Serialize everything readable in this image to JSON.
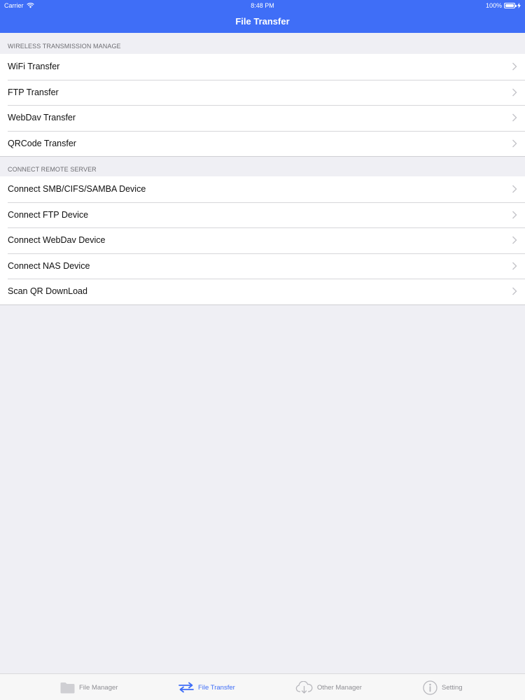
{
  "status_bar": {
    "carrier": "Carrier",
    "time": "8:48 PM",
    "battery_text": "100%",
    "battery_level": 1.0
  },
  "nav": {
    "title": "File Transfer"
  },
  "sections": [
    {
      "header": "WIRELESS TRANSMISSION MANAGE",
      "items": [
        {
          "label": "WiFi Transfer"
        },
        {
          "label": "FTP Transfer"
        },
        {
          "label": "WebDav Transfer"
        },
        {
          "label": "QRCode Transfer"
        }
      ]
    },
    {
      "header": "CONNECT REMOTE SERVER",
      "items": [
        {
          "label": "Connect SMB/CIFS/SAMBA Device"
        },
        {
          "label": "Connect FTP Device"
        },
        {
          "label": "Connect WebDav Device"
        },
        {
          "label": "Connect NAS Device"
        },
        {
          "label": "Scan QR DownLoad"
        }
      ]
    }
  ],
  "tabbar": {
    "tabs": [
      {
        "label": "File Manager",
        "icon": "folder-icon",
        "active": false
      },
      {
        "label": "File Transfer",
        "icon": "transfer-arrows-icon",
        "active": true
      },
      {
        "label": "Other Manager",
        "icon": "cloud-download-icon",
        "active": false
      },
      {
        "label": "Setting",
        "icon": "info-icon",
        "active": false
      }
    ]
  },
  "colors": {
    "accent": "#3f6ef7",
    "background": "#efeff4",
    "inactive_tab": "#8e8e93"
  }
}
